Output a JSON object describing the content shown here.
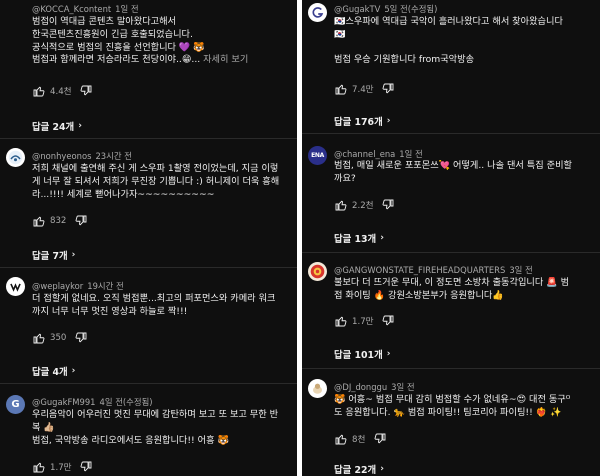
{
  "left": {
    "comments": [
      {
        "handle": "@KOCCA_Kcontent",
        "age": "1일 전",
        "lines": [
          "범접이 역대급 콘텐츠 말아왔다고해서",
          "한국콘텐츠진흥원이 긴급 호출되었습니다.",
          "공식적으로 범접의 진흥을 선언합니다 💜 🐯",
          "범접과 함께라면 저승라라도 천당이야..😁... "
        ],
        "more": "자세히 보기",
        "likes": "4.4천",
        "replies": "답글 24개"
      },
      {
        "handle": "@nonhyeonos",
        "age": "23시간 전",
        "lines": [
          "저희 채널에 출연해 주신 게 스우파 1촬영 전이었는데, 지금 이렇",
          "게 너무 잘 되셔서 저희가 무진장 기쁩니다 :) 허니제이 더욱 흥해",
          "라...!!!! 세계로 뻗어나가자~~~~~~~~~~"
        ],
        "likes": "832",
        "replies": "답글 7개"
      },
      {
        "handle": "@weplaykor",
        "age": "19시간 전",
        "lines": [
          "더 접할게 없네요. 오직 범접뿐...최고의 퍼포먼스와 카메라 워크",
          "까지 너무 너무 멋진 영상과 하늘로 짝!!!"
        ],
        "likes": "350",
        "replies": "답글 4개"
      },
      {
        "handle": "@GugakFM991",
        "age": "4일 전(수정됨)",
        "lines": [
          "우리음악이 어우러진 멋진 무대에 감탄하며 보고 또 보고 무한 반",
          "복 👍🏼",
          "범접, 국악방송 라디오에서도 응원합니다!! 어흥 🐯"
        ],
        "likes": "1.7만",
        "replies": ""
      }
    ]
  },
  "right": {
    "comments": [
      {
        "handle": "@GugakTV",
        "age": "5일 전(수정됨)",
        "lines": [
          "🇰🇷스우파에 역대급 국악이 흘러나왔다고 해서 찾아왔습니다",
          "🇰🇷",
          "",
          "범접 우승 기원합니다 from국악방송"
        ],
        "likes": "7.4만",
        "replies": "답글 176개"
      },
      {
        "handle": "@channel_ena",
        "age": "1일 전",
        "lines": [
          "범접, 매일 새로운 포포몬쓰💘 어떻게.. 나솔 댄서 특집 준비할",
          "까요?"
        ],
        "likes": "2.2천",
        "replies": "답글 13개"
      },
      {
        "handle": "@GANGWONSTATE_FIREHEADQUARTERS",
        "age": "3일 전",
        "lines": [
          "불보다 더 뜨거운 무대, 이 정도면 소방차 출동각입니다 🚨 범",
          "접 화이팅 🔥 강원소방본부가 응원합니다👍"
        ],
        "likes": "1.7만",
        "replies": "답글 101개"
      },
      {
        "handle": "@DJ_donggu",
        "age": "3일 전",
        "lines": [
          "🐯 어흥~ 범접 무대 감히 범접할 수가 없네유~😍 대전 동구ᴼ",
          "도 응원합니다. 🐆 범접 파이팅!! 팀코리아 파이팅!! ❤️‍🔥 ✨"
        ],
        "likes": "8천",
        "replies": "답글 22개"
      }
    ]
  }
}
